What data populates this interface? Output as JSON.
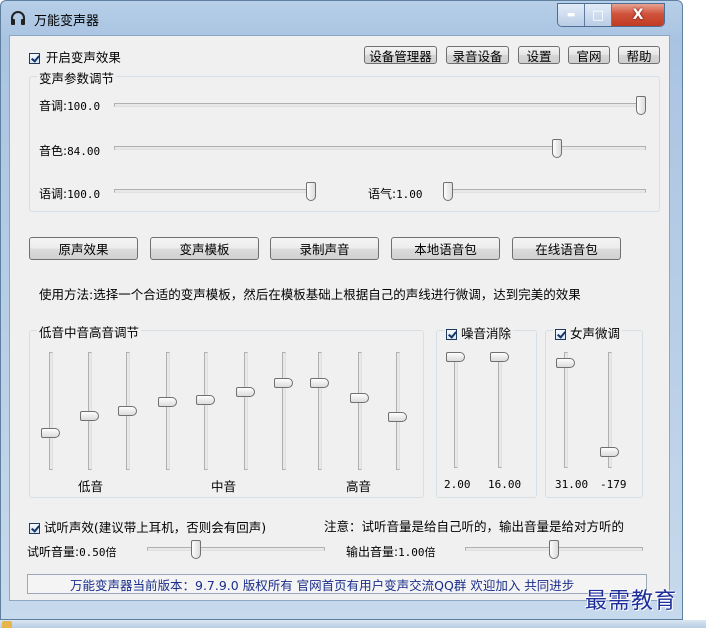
{
  "window": {
    "title": "万能变声器",
    "buttons": {
      "minimize": "▬",
      "maximize": "□",
      "close": "X"
    }
  },
  "top": {
    "enable_effect_label": "开启变声效果",
    "enable_effect_checked": true,
    "buttons": [
      "设备管理器",
      "录音设备",
      "设置",
      "官网",
      "帮助"
    ]
  },
  "params": {
    "legend": "变声参数调节",
    "pitch": {
      "label": "音调",
      "value": "100.0",
      "level": 1.0
    },
    "timbre": {
      "label": "音色",
      "value": "84.00",
      "level": 0.84
    },
    "tone": {
      "label": "语调",
      "value": "100.0",
      "level": 1.0
    },
    "mood": {
      "label": "语气",
      "value": "1.00",
      "level": 0.0
    }
  },
  "actions": [
    "原声效果",
    "变声模板",
    "录制声音",
    "本地语音包",
    "在线语音包"
  ],
  "usage_text": "使用方法:选择一个合适的变声模板，然后在模板基础上根据自己的声线进行微调，达到完美的效果",
  "eq": {
    "legend": "低音中音高音调节",
    "labels": {
      "low": "低音",
      "mid": "中音",
      "high": "高音"
    },
    "levels": [
      0.3,
      0.45,
      0.5,
      0.58,
      0.6,
      0.68,
      0.76,
      0.76,
      0.62,
      0.44
    ]
  },
  "noise": {
    "label": "噪音消除",
    "checked": true,
    "values": [
      "2.00",
      "16.00"
    ],
    "levels": [
      1.0,
      1.0
    ]
  },
  "female": {
    "label": "女声微调",
    "checked": true,
    "values": [
      "31.00",
      "-179"
    ],
    "levels": [
      0.94,
      0.1
    ]
  },
  "monitor": {
    "label": "试听声效(建议带上耳机，否则会有回声)",
    "checked": true,
    "note": "注意：试听音量是给自己听的，输出音量是给对方听的",
    "listen_label": "试听音量",
    "listen_value": "0.50倍",
    "listen_level": 0.26,
    "output_label": "输出音量",
    "output_value": "1.00倍",
    "output_level": 0.5
  },
  "status_text": "万能变声器当前版本：9.7.9.0  版权所有  官网首页有用户变声交流QQ群 欢迎加入 共同进步",
  "watermark": "最需教育"
}
